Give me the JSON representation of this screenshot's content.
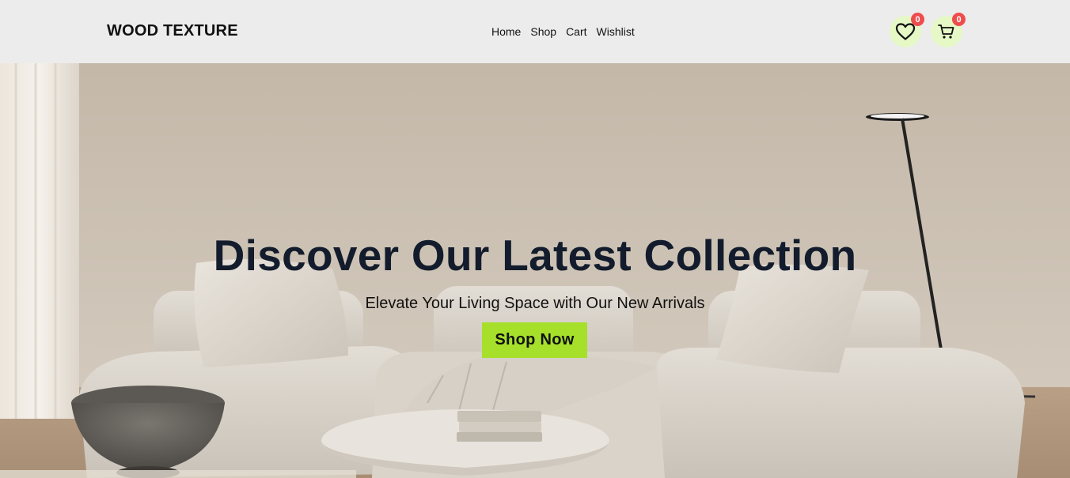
{
  "header": {
    "logo": "WOOD TEXTURE",
    "nav": [
      "Home",
      "Shop",
      "Cart",
      "Wishlist"
    ],
    "wishlist_count": "0",
    "cart_count": "0"
  },
  "hero": {
    "title": "Discover Our Latest Collection",
    "subtitle": "Elevate Your Living Space with Our New Arrivals",
    "cta_label": "Shop Now"
  },
  "colors": {
    "accent": "#a6e02a",
    "badge": "#ee4d4d",
    "icon_bg": "#e5f8c6",
    "title": "#131c2c"
  },
  "icons": [
    "heart-icon",
    "cart-icon"
  ]
}
